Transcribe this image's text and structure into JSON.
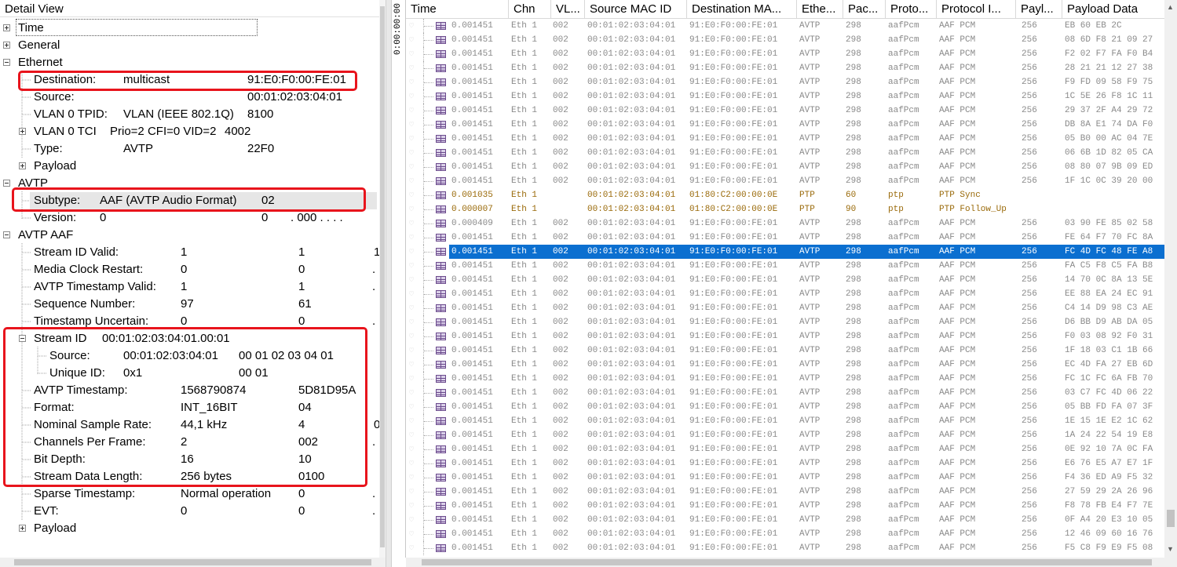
{
  "detail_view": {
    "title": "Detail View",
    "rows": [
      {
        "name": "Time",
        "value": "",
        "raw": "",
        "extra": ""
      },
      {
        "name": "General",
        "value": "",
        "raw": "",
        "extra": ""
      },
      {
        "name": "Ethernet",
        "value": "",
        "raw": "",
        "extra": ""
      },
      {
        "name": "Destination:",
        "value": "multicast",
        "raw": "91:E0:F0:00:FE:01",
        "extra": ""
      },
      {
        "name": "Source:",
        "value": "",
        "raw": "00:01:02:03:04:01",
        "extra": ""
      },
      {
        "name": "VLAN 0 TPID:",
        "value": "VLAN (IEEE 802.1Q)",
        "raw": "8100",
        "extra": ""
      },
      {
        "name": "VLAN 0 TCI",
        "value": "Prio=2 CFI=0 VID=2",
        "raw": "4002",
        "extra": ""
      },
      {
        "name": "Type:",
        "value": "AVTP",
        "raw": "22F0",
        "extra": ""
      },
      {
        "name": "Payload",
        "value": "",
        "raw": "",
        "extra": ""
      },
      {
        "name": "AVTP",
        "value": "",
        "raw": "",
        "extra": ""
      },
      {
        "name": "Subtype:",
        "value": "AAF (AVTP Audio Format)",
        "raw": "02",
        "extra": ""
      },
      {
        "name": "Version:",
        "value": "0",
        "raw": "0",
        "extra": ". 000 . . . ."
      },
      {
        "name": "AVTP AAF",
        "value": "",
        "raw": "",
        "extra": ""
      },
      {
        "name": "Stream ID Valid:",
        "value": "1",
        "raw": "1",
        "extra": "1"
      },
      {
        "name": "Media Clock Restart:",
        "value": "0",
        "raw": "0",
        "extra": ". ."
      },
      {
        "name": "AVTP Timestamp Valid:",
        "value": "1",
        "raw": "1",
        "extra": ". ."
      },
      {
        "name": "Sequence Number:",
        "value": "97",
        "raw": "61",
        "extra": ""
      },
      {
        "name": "Timestamp Uncertain:",
        "value": "0",
        "raw": "0",
        "extra": ". ."
      },
      {
        "name": "Stream ID",
        "value": "00:01:02:03:04:01.00:01",
        "raw": "",
        "extra": ""
      },
      {
        "name": "Source:",
        "value": "00:01:02:03:04:01",
        "raw": "00 01 02 03 04 01",
        "extra": ""
      },
      {
        "name": "Unique ID:",
        "value": "0x1",
        "raw": "00 01",
        "extra": ""
      },
      {
        "name": "AVTP Timestamp:",
        "value": "1568790874",
        "raw": "5D81D95A",
        "extra": ""
      },
      {
        "name": "Format:",
        "value": "INT_16BIT",
        "raw": "04",
        "extra": ""
      },
      {
        "name": "Nominal Sample Rate:",
        "value": "44,1 kHz",
        "raw": "4",
        "extra": "0"
      },
      {
        "name": "Channels Per Frame:",
        "value": "2",
        "raw": "002",
        "extra": ". ."
      },
      {
        "name": "Bit Depth:",
        "value": "16",
        "raw": "10",
        "extra": ""
      },
      {
        "name": "Stream Data Length:",
        "value": "256 bytes",
        "raw": "0100",
        "extra": ""
      },
      {
        "name": "Sparse Timestamp:",
        "value": "Normal operation",
        "raw": "0",
        "extra": ". ."
      },
      {
        "name": "EVT:",
        "value": "0",
        "raw": "0",
        "extra": ". ."
      },
      {
        "name": "Payload",
        "value": "",
        "raw": "",
        "extra": ""
      }
    ]
  },
  "time_axis_label": "0:00:00:00",
  "packet_list": {
    "columns": [
      "Time",
      "Chn",
      "VL...",
      "Source MAC ID",
      "Destination MA...",
      "Ethe...",
      "Pac...",
      "Proto...",
      "Protocol I...",
      "Payl...",
      "Payload Data"
    ],
    "rows": [
      {
        "time": "0.001451",
        "chn": "Eth 1",
        "vl": "002",
        "src": "00:01:02:03:04:01",
        "dst": "91:E0:F0:00:FE:01",
        "eth": "AVTP",
        "pac": "298",
        "proto": "aafPcm",
        "protoi": "AAF PCM",
        "payl": "256",
        "data": "EB 60 EB 2C"
      },
      {
        "time": "0.001451",
        "chn": "Eth 1",
        "vl": "002",
        "src": "00:01:02:03:04:01",
        "dst": "91:E0:F0:00:FE:01",
        "eth": "AVTP",
        "pac": "298",
        "proto": "aafPcm",
        "protoi": "AAF PCM",
        "payl": "256",
        "data": "08 6D F8 21 09 27"
      },
      {
        "time": "0.001451",
        "chn": "Eth 1",
        "vl": "002",
        "src": "00:01:02:03:04:01",
        "dst": "91:E0:F0:00:FE:01",
        "eth": "AVTP",
        "pac": "298",
        "proto": "aafPcm",
        "protoi": "AAF PCM",
        "payl": "256",
        "data": "F2 02 F7 FA F0 B4"
      },
      {
        "time": "0.001451",
        "chn": "Eth 1",
        "vl": "002",
        "src": "00:01:02:03:04:01",
        "dst": "91:E0:F0:00:FE:01",
        "eth": "AVTP",
        "pac": "298",
        "proto": "aafPcm",
        "protoi": "AAF PCM",
        "payl": "256",
        "data": "28 21 21 12 27 38"
      },
      {
        "time": "0.001451",
        "chn": "Eth 1",
        "vl": "002",
        "src": "00:01:02:03:04:01",
        "dst": "91:E0:F0:00:FE:01",
        "eth": "AVTP",
        "pac": "298",
        "proto": "aafPcm",
        "protoi": "AAF PCM",
        "payl": "256",
        "data": "F9 FD 09 58 F9 75"
      },
      {
        "time": "0.001451",
        "chn": "Eth 1",
        "vl": "002",
        "src": "00:01:02:03:04:01",
        "dst": "91:E0:F0:00:FE:01",
        "eth": "AVTP",
        "pac": "298",
        "proto": "aafPcm",
        "protoi": "AAF PCM",
        "payl": "256",
        "data": "1C 5E 26 F8 1C 11"
      },
      {
        "time": "0.001451",
        "chn": "Eth 1",
        "vl": "002",
        "src": "00:01:02:03:04:01",
        "dst": "91:E0:F0:00:FE:01",
        "eth": "AVTP",
        "pac": "298",
        "proto": "aafPcm",
        "protoi": "AAF PCM",
        "payl": "256",
        "data": "29 37 2F A4 29 72"
      },
      {
        "time": "0.001451",
        "chn": "Eth 1",
        "vl": "002",
        "src": "00:01:02:03:04:01",
        "dst": "91:E0:F0:00:FE:01",
        "eth": "AVTP",
        "pac": "298",
        "proto": "aafPcm",
        "protoi": "AAF PCM",
        "payl": "256",
        "data": "DB 8A E1 74 DA F0"
      },
      {
        "time": "0.001451",
        "chn": "Eth 1",
        "vl": "002",
        "src": "00:01:02:03:04:01",
        "dst": "91:E0:F0:00:FE:01",
        "eth": "AVTP",
        "pac": "298",
        "proto": "aafPcm",
        "protoi": "AAF PCM",
        "payl": "256",
        "data": "05 B0 00 AC 04 7E"
      },
      {
        "time": "0.001451",
        "chn": "Eth 1",
        "vl": "002",
        "src": "00:01:02:03:04:01",
        "dst": "91:E0:F0:00:FE:01",
        "eth": "AVTP",
        "pac": "298",
        "proto": "aafPcm",
        "protoi": "AAF PCM",
        "payl": "256",
        "data": "06 6B 1D 82 05 CA"
      },
      {
        "time": "0.001451",
        "chn": "Eth 1",
        "vl": "002",
        "src": "00:01:02:03:04:01",
        "dst": "91:E0:F0:00:FE:01",
        "eth": "AVTP",
        "pac": "298",
        "proto": "aafPcm",
        "protoi": "AAF PCM",
        "payl": "256",
        "data": "08 80 07 9B 09 ED"
      },
      {
        "time": "0.001451",
        "chn": "Eth 1",
        "vl": "002",
        "src": "00:01:02:03:04:01",
        "dst": "91:E0:F0:00:FE:01",
        "eth": "AVTP",
        "pac": "298",
        "proto": "aafPcm",
        "protoi": "AAF PCM",
        "payl": "256",
        "data": "1F 1C 0C 39 20 00"
      },
      {
        "time": "0.001035",
        "chn": "Eth 1",
        "vl": "",
        "src": "00:01:02:03:04:01",
        "dst": "01:80:C2:00:00:0E",
        "eth": "PTP",
        "pac": "60",
        "proto": "ptp",
        "protoi": "PTP Sync",
        "payl": "",
        "data": "",
        "kind": "ptp"
      },
      {
        "time": "0.000007",
        "chn": "Eth 1",
        "vl": "",
        "src": "00:01:02:03:04:01",
        "dst": "01:80:C2:00:00:0E",
        "eth": "PTP",
        "pac": "90",
        "proto": "ptp",
        "protoi": "PTP Follow_Up",
        "payl": "",
        "data": "",
        "kind": "ptp"
      },
      {
        "time": "0.000409",
        "chn": "Eth 1",
        "vl": "002",
        "src": "00:01:02:03:04:01",
        "dst": "91:E0:F0:00:FE:01",
        "eth": "AVTP",
        "pac": "298",
        "proto": "aafPcm",
        "protoi": "AAF PCM",
        "payl": "256",
        "data": "03 90 FE 85 02 58"
      },
      {
        "time": "0.001451",
        "chn": "Eth 1",
        "vl": "002",
        "src": "00:01:02:03:04:01",
        "dst": "91:E0:F0:00:FE:01",
        "eth": "AVTP",
        "pac": "298",
        "proto": "aafPcm",
        "protoi": "AAF PCM",
        "payl": "256",
        "data": "FE 64 F7 70 FC 8A"
      },
      {
        "time": "0.001451",
        "chn": "Eth 1",
        "vl": "002",
        "src": "00:01:02:03:04:01",
        "dst": "91:E0:F0:00:FE:01",
        "eth": "AVTP",
        "pac": "298",
        "proto": "aafPcm",
        "protoi": "AAF PCM",
        "payl": "256",
        "data": "FC 4D FC 48 FE A8",
        "kind": "selected"
      },
      {
        "time": "0.001451",
        "chn": "Eth 1",
        "vl": "002",
        "src": "00:01:02:03:04:01",
        "dst": "91:E0:F0:00:FE:01",
        "eth": "AVTP",
        "pac": "298",
        "proto": "aafPcm",
        "protoi": "AAF PCM",
        "payl": "256",
        "data": "FA C5 F8 C5 FA B8"
      },
      {
        "time": "0.001451",
        "chn": "Eth 1",
        "vl": "002",
        "src": "00:01:02:03:04:01",
        "dst": "91:E0:F0:00:FE:01",
        "eth": "AVTP",
        "pac": "298",
        "proto": "aafPcm",
        "protoi": "AAF PCM",
        "payl": "256",
        "data": "14 70 0C 8A 13 5E"
      },
      {
        "time": "0.001451",
        "chn": "Eth 1",
        "vl": "002",
        "src": "00:01:02:03:04:01",
        "dst": "91:E0:F0:00:FE:01",
        "eth": "AVTP",
        "pac": "298",
        "proto": "aafPcm",
        "protoi": "AAF PCM",
        "payl": "256",
        "data": "EE 88 EA 24 EC 91"
      },
      {
        "time": "0.001451",
        "chn": "Eth 1",
        "vl": "002",
        "src": "00:01:02:03:04:01",
        "dst": "91:E0:F0:00:FE:01",
        "eth": "AVTP",
        "pac": "298",
        "proto": "aafPcm",
        "protoi": "AAF PCM",
        "payl": "256",
        "data": "C4 14 D9 98 C3 AE"
      },
      {
        "time": "0.001451",
        "chn": "Eth 1",
        "vl": "002",
        "src": "00:01:02:03:04:01",
        "dst": "91:E0:F0:00:FE:01",
        "eth": "AVTP",
        "pac": "298",
        "proto": "aafPcm",
        "protoi": "AAF PCM",
        "payl": "256",
        "data": "D6 BB D9 AB DA 05"
      },
      {
        "time": "0.001451",
        "chn": "Eth 1",
        "vl": "002",
        "src": "00:01:02:03:04:01",
        "dst": "91:E0:F0:00:FE:01",
        "eth": "AVTP",
        "pac": "298",
        "proto": "aafPcm",
        "protoi": "AAF PCM",
        "payl": "256",
        "data": "F0 03 08 92 F0 31"
      },
      {
        "time": "0.001451",
        "chn": "Eth 1",
        "vl": "002",
        "src": "00:01:02:03:04:01",
        "dst": "91:E0:F0:00:FE:01",
        "eth": "AVTP",
        "pac": "298",
        "proto": "aafPcm",
        "protoi": "AAF PCM",
        "payl": "256",
        "data": "1F 18 03 C1 1B 66"
      },
      {
        "time": "0.001451",
        "chn": "Eth 1",
        "vl": "002",
        "src": "00:01:02:03:04:01",
        "dst": "91:E0:F0:00:FE:01",
        "eth": "AVTP",
        "pac": "298",
        "proto": "aafPcm",
        "protoi": "AAF PCM",
        "payl": "256",
        "data": "EC 4D FA 27 EB 6D"
      },
      {
        "time": "0.001451",
        "chn": "Eth 1",
        "vl": "002",
        "src": "00:01:02:03:04:01",
        "dst": "91:E0:F0:00:FE:01",
        "eth": "AVTP",
        "pac": "298",
        "proto": "aafPcm",
        "protoi": "AAF PCM",
        "payl": "256",
        "data": "FC 1C FC 6A FB 70"
      },
      {
        "time": "0.001451",
        "chn": "Eth 1",
        "vl": "002",
        "src": "00:01:02:03:04:01",
        "dst": "91:E0:F0:00:FE:01",
        "eth": "AVTP",
        "pac": "298",
        "proto": "aafPcm",
        "protoi": "AAF PCM",
        "payl": "256",
        "data": "03 C7 FC 4D 06 22"
      },
      {
        "time": "0.001451",
        "chn": "Eth 1",
        "vl": "002",
        "src": "00:01:02:03:04:01",
        "dst": "91:E0:F0:00:FE:01",
        "eth": "AVTP",
        "pac": "298",
        "proto": "aafPcm",
        "protoi": "AAF PCM",
        "payl": "256",
        "data": "05 BB FD FA 07 3F"
      },
      {
        "time": "0.001451",
        "chn": "Eth 1",
        "vl": "002",
        "src": "00:01:02:03:04:01",
        "dst": "91:E0:F0:00:FE:01",
        "eth": "AVTP",
        "pac": "298",
        "proto": "aafPcm",
        "protoi": "AAF PCM",
        "payl": "256",
        "data": "1E 15 1E E2 1C 62"
      },
      {
        "time": "0.001451",
        "chn": "Eth 1",
        "vl": "002",
        "src": "00:01:02:03:04:01",
        "dst": "91:E0:F0:00:FE:01",
        "eth": "AVTP",
        "pac": "298",
        "proto": "aafPcm",
        "protoi": "AAF PCM",
        "payl": "256",
        "data": "1A 24 22 54 19 E8"
      },
      {
        "time": "0.001451",
        "chn": "Eth 1",
        "vl": "002",
        "src": "00:01:02:03:04:01",
        "dst": "91:E0:F0:00:FE:01",
        "eth": "AVTP",
        "pac": "298",
        "proto": "aafPcm",
        "protoi": "AAF PCM",
        "payl": "256",
        "data": "0E 92 10 7A 0C FA"
      },
      {
        "time": "0.001451",
        "chn": "Eth 1",
        "vl": "002",
        "src": "00:01:02:03:04:01",
        "dst": "91:E0:F0:00:FE:01",
        "eth": "AVTP",
        "pac": "298",
        "proto": "aafPcm",
        "protoi": "AAF PCM",
        "payl": "256",
        "data": "E6 76 E5 A7 E7 1F"
      },
      {
        "time": "0.001451",
        "chn": "Eth 1",
        "vl": "002",
        "src": "00:01:02:03:04:01",
        "dst": "91:E0:F0:00:FE:01",
        "eth": "AVTP",
        "pac": "298",
        "proto": "aafPcm",
        "protoi": "AAF PCM",
        "payl": "256",
        "data": "F4 36 ED A9 F5 32"
      },
      {
        "time": "0.001451",
        "chn": "Eth 1",
        "vl": "002",
        "src": "00:01:02:03:04:01",
        "dst": "91:E0:F0:00:FE:01",
        "eth": "AVTP",
        "pac": "298",
        "proto": "aafPcm",
        "protoi": "AAF PCM",
        "payl": "256",
        "data": "27 59 29 2A 26 96"
      },
      {
        "time": "0.001451",
        "chn": "Eth 1",
        "vl": "002",
        "src": "00:01:02:03:04:01",
        "dst": "91:E0:F0:00:FE:01",
        "eth": "AVTP",
        "pac": "298",
        "proto": "aafPcm",
        "protoi": "AAF PCM",
        "payl": "256",
        "data": "F8 78 FB E4 F7 7E"
      },
      {
        "time": "0.001451",
        "chn": "Eth 1",
        "vl": "002",
        "src": "00:01:02:03:04:01",
        "dst": "91:E0:F0:00:FE:01",
        "eth": "AVTP",
        "pac": "298",
        "proto": "aafPcm",
        "protoi": "AAF PCM",
        "payl": "256",
        "data": "0F A4 20 E3 10 05"
      },
      {
        "time": "0.001451",
        "chn": "Eth 1",
        "vl": "002",
        "src": "00:01:02:03:04:01",
        "dst": "91:E0:F0:00:FE:01",
        "eth": "AVTP",
        "pac": "298",
        "proto": "aafPcm",
        "protoi": "AAF PCM",
        "payl": "256",
        "data": "12 46 09 60 16 76"
      },
      {
        "time": "0.001451",
        "chn": "Eth 1",
        "vl": "002",
        "src": "00:01:02:03:04:01",
        "dst": "91:E0:F0:00:FE:01",
        "eth": "AVTP",
        "pac": "298",
        "proto": "aafPcm",
        "protoi": "AAF PCM",
        "payl": "256",
        "data": "F5 C8 F9 E9 F5 08"
      }
    ]
  },
  "colors": {
    "highlight_box": "#e8141c",
    "selected_row": "#0b6fd0",
    "ptp_text": "#9a6a0a",
    "avtp_text": "#8a8a8a"
  }
}
